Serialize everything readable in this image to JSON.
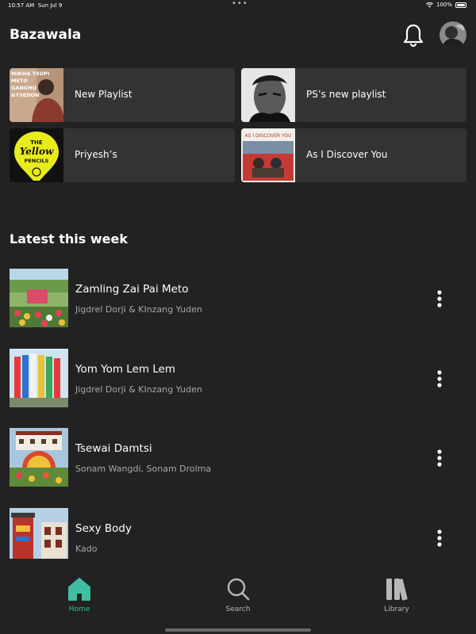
{
  "status": {
    "time": "10:57 AM",
    "date": "Sun Jul 9",
    "battery": "100%"
  },
  "header": {
    "title": "Bazawala"
  },
  "playlists": [
    {
      "name": "New Playlist",
      "art_text": "MIKHA TSUPI METO GANGHU &TSEDON"
    },
    {
      "name": "PS’s new playlist"
    },
    {
      "name": "Priyesh’s",
      "art_text": "THE Yellow PENCILS"
    },
    {
      "name": "As I Discover You",
      "art_text": "AS I DISCOVER YOU"
    }
  ],
  "section": {
    "title": "Latest this week"
  },
  "songs": [
    {
      "title": "Zamling Zai Pai Meto",
      "artist": "Jigdrel Dorji & KInzang Yuden"
    },
    {
      "title": "Yom Yom Lem Lem",
      "artist": "Jigdrel Dorji & KInzang Yuden"
    },
    {
      "title": "Tsewai Damtsi",
      "artist": "Sonam Wangdi, Sonam Drolma"
    },
    {
      "title": "Sexy Body",
      "artist": "Kado"
    }
  ],
  "nav": {
    "home": "Home",
    "search": "Search",
    "library": "Library"
  },
  "colors": {
    "accent": "#3fbfa0",
    "background": "#222222",
    "tile": "#333333"
  },
  "icons": [
    "bell-icon",
    "home-icon",
    "search-icon",
    "library-icon",
    "more-vertical-icon"
  ]
}
